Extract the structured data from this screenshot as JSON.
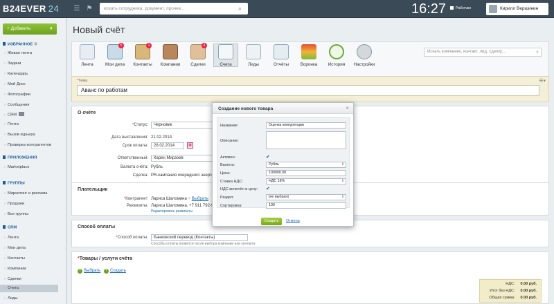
{
  "header": {
    "logo_main": "B24EVER",
    "logo_num": "24",
    "search_placeholder": "искать сотрудника, документ, прочее...",
    "clock": "16:27",
    "worktime_label": "Работаю",
    "user_name": "Кирилл Вершинин"
  },
  "sidebar": {
    "add_button": "Добавить",
    "sections": {
      "favorites": "ИЗБРАННОЕ",
      "apps": "ПРИЛОЖЕНИЯ",
      "groups": "ГРУППЫ",
      "crm": "CRM"
    },
    "favorites_items": [
      "Живая лента",
      "Задачи",
      "Календарь",
      "Мой Диск",
      "Фотографии",
      "Сообщения",
      "CRM",
      "Почта",
      "Вызов курьера",
      "Проверка контрагентов"
    ],
    "apps_items": [
      "Marketplace"
    ],
    "groups_items": [
      "Маркетинг и реклама",
      "Продажи",
      "Все группы"
    ],
    "crm_items": [
      "Лента",
      "Мои дела",
      "Контакты",
      "Компании",
      "Сделки",
      "Счета",
      "Лиды"
    ],
    "active_item": "Счета"
  },
  "main": {
    "title": "Новый счёт",
    "toolbar": [
      {
        "label": "Лента",
        "icon": "feed-icon"
      },
      {
        "label": "Мои дела",
        "icon": "tasks-icon",
        "badge": "5"
      },
      {
        "label": "Контакты",
        "icon": "contacts-icon",
        "badge": "1"
      },
      {
        "label": "Компании",
        "icon": "companies-icon"
      },
      {
        "label": "Сделки",
        "icon": "deals-icon",
        "badge": "4"
      },
      {
        "label": "Счета",
        "icon": "invoices-icon"
      },
      {
        "label": "Лиды",
        "icon": "leads-icon"
      },
      {
        "label": "Отчёты",
        "icon": "reports-icon"
      },
      {
        "label": "Воронка",
        "icon": "funnel-icon"
      },
      {
        "label": "История",
        "icon": "history-icon"
      },
      {
        "label": "Настройки",
        "icon": "settings-icon"
      }
    ],
    "toolbar_search_placeholder": "Искать компанию, контакт, лид, сделку...",
    "theme": {
      "label": "Тема",
      "value": "Аванс по работам"
    },
    "about": {
      "title": "О счёте",
      "status_label": "Статус:",
      "status_value": "Черновик",
      "issued_label": "Дата выставления:",
      "issued_value": "21.02.2014",
      "due_label": "Срок оплаты:",
      "due_value": "28.02.2014",
      "responsible_label": "Ответственный:",
      "responsible_value": "Карен Мирзоев",
      "currency_label": "Валюта счёта:",
      "currency_value": "Рубль",
      "deal_label": "Сделка:",
      "deal_value": "PR-кампания очередного энергет"
    },
    "payer": {
      "title": "Плательщик",
      "counterparty_label": "Контрагент:",
      "counterparty_value": "Лариса Шаломина",
      "counterparty_action": "Выбрать",
      "requisites_label": "Реквизиты:",
      "requisites_value": "Лариса Шаломина, +7 911 792-93",
      "requisites_edit": "Редактировать реквизиты"
    },
    "payment": {
      "title": "Способ оплаты",
      "method_label": "Способ оплаты:",
      "method_value": "Банковский перевод (Контакты)",
      "note": "Способы оплаты появятся после выбора компании или контакта"
    },
    "goods": {
      "title": "Товары / услуги счёта",
      "select_link": "Выбрать",
      "create_link": "Создать"
    },
    "totals": {
      "vat_label": "НДС:",
      "vat_value": "0.00 руб.",
      "net_label": "Итог без НДС:",
      "net_value": "0.00 руб.",
      "sum_label": "Общая сумма:",
      "sum_value": "0.00 руб."
    }
  },
  "dialog": {
    "title": "Создание нового товара",
    "name_label": "Название:",
    "name_value": "Оценка конкуренции",
    "desc_label": "Описание:",
    "active_label": "Активен:",
    "currency_label": "Валюта:",
    "currency_value": "Рубль",
    "price_label": "Цена:",
    "price_value": "100000.00",
    "vat_rate_label": "Ставка НДС:",
    "vat_rate_value": "НДС 18%",
    "vat_incl_label": "НДС включён в цену:",
    "section_label": "Раздел:",
    "section_value": "[не выбран]",
    "sort_label": "Сортировка:",
    "sort_value": "100",
    "create_button": "Создать",
    "cancel_link": "Отмена"
  },
  "colors": {
    "accent": "#6ea11d",
    "header": "#3b4a57",
    "link": "#1c6bb8"
  }
}
